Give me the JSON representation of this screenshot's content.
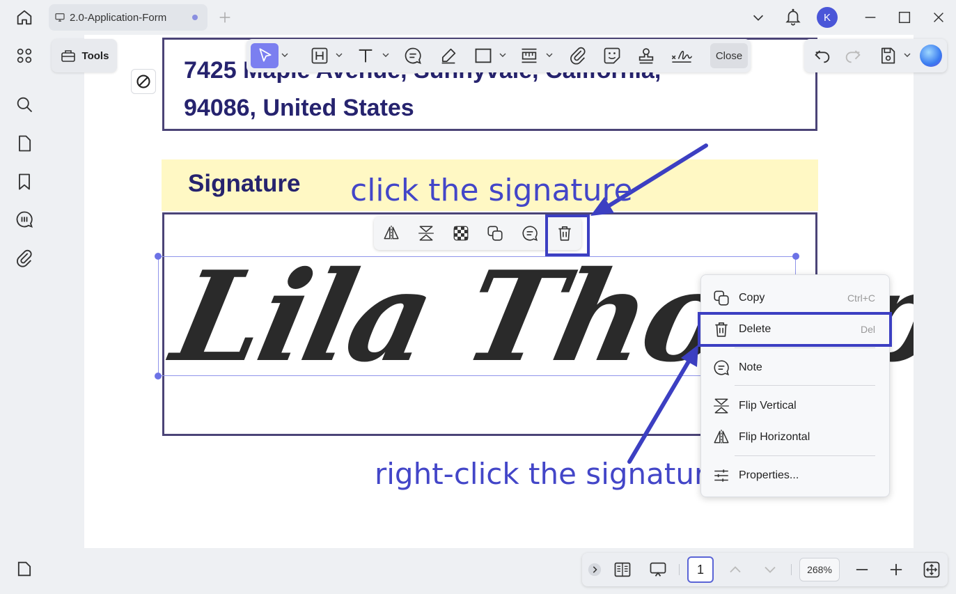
{
  "tab": {
    "title": "2.0-Application-Form"
  },
  "user": {
    "initial": "K"
  },
  "tools": {
    "label": "Tools"
  },
  "toolbar": {
    "close_label": "Close"
  },
  "document": {
    "address_line1": "7425 Maple Avenue, Sunnyvale, California,",
    "address_line2": "94086, United States",
    "signature_heading": "Signature",
    "signature_value": "Lila Thompson"
  },
  "annotations": {
    "click_hint": "click the signature",
    "right_click_hint": "right-click the signature"
  },
  "context_menu": {
    "items": [
      {
        "label": "Copy",
        "shortcut": "Ctrl+C"
      },
      {
        "label": "Delete",
        "shortcut": "Del"
      },
      {
        "label": "Note",
        "shortcut": ""
      },
      {
        "label": "Flip Vertical",
        "shortcut": ""
      },
      {
        "label": "Flip Horizontal",
        "shortcut": ""
      },
      {
        "label": "Properties...",
        "shortcut": ""
      }
    ]
  },
  "bottom": {
    "page": "1",
    "zoom": "268%"
  },
  "colors": {
    "accent": "#4a56d8",
    "annotation": "#3c3fc2",
    "heading": "#26236e",
    "band": "#fff8c4"
  }
}
